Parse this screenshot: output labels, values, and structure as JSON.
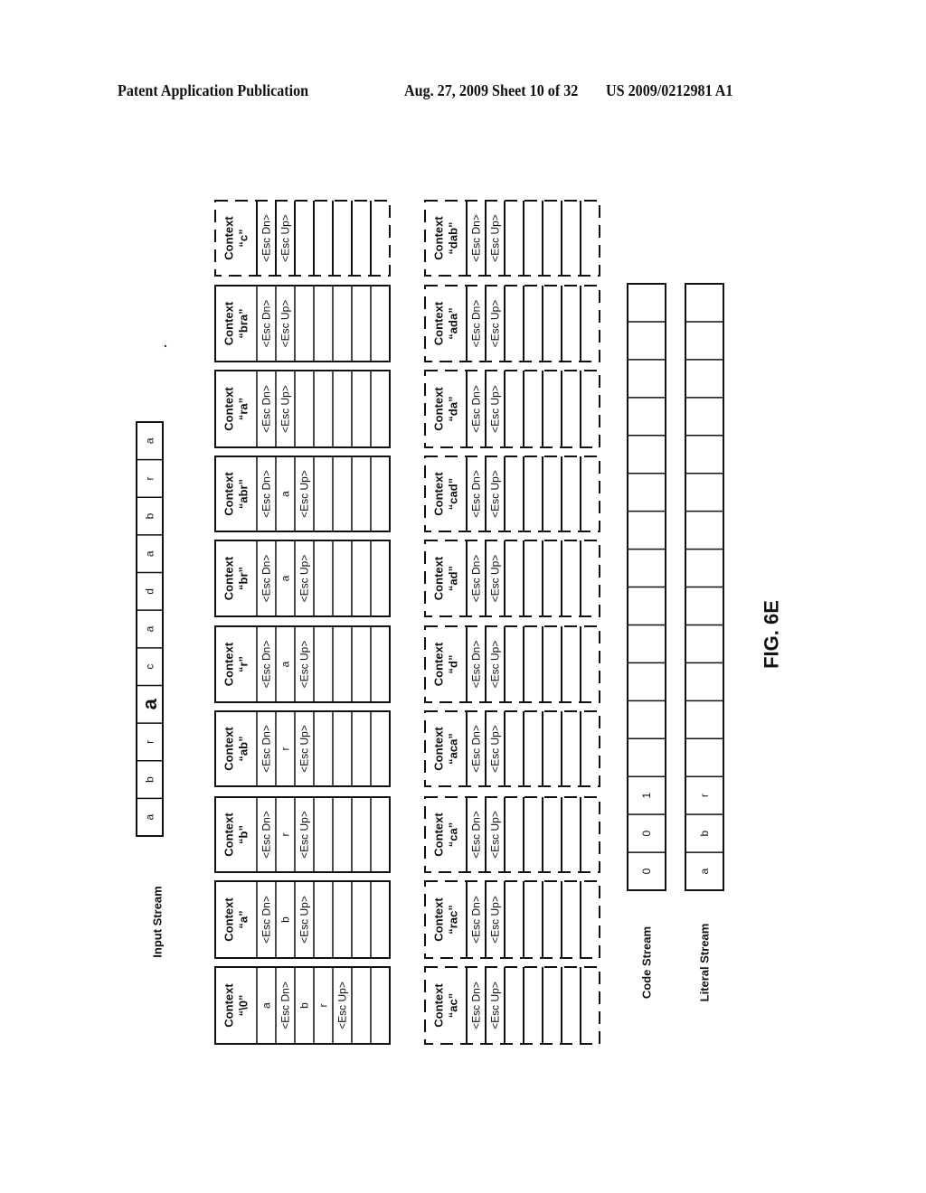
{
  "header": {
    "left": "Patent Application Publication",
    "middle": "Aug. 27, 2009  Sheet 10 of 32",
    "right": "US 2009/0212981 A1"
  },
  "figure": {
    "title": "FIG. 6E",
    "orientation": "rotated 90 degrees counter-clockwise",
    "input_stream": {
      "label": "Input Stream",
      "symbols": [
        "a",
        "b",
        "r",
        "a",
        "c",
        "a",
        "d",
        "a",
        "b",
        "r",
        "a"
      ],
      "highlighted_index": 3
    },
    "context_row_1": [
      {
        "name": "Context",
        "key": "“\\0”",
        "entries": [
          "a",
          "<Esc Dn>",
          "b",
          "r",
          "<Esc Up>",
          "",
          ""
        ],
        "style": "solid"
      },
      {
        "name": "Context",
        "key": "“a”",
        "entries": [
          "<Esc Dn>",
          "b",
          "<Esc Up>",
          "",
          "",
          "",
          ""
        ],
        "style": "solid"
      },
      {
        "name": "Context",
        "key": "“b”",
        "entries": [
          "<Esc Dn>",
          "r",
          "<Esc Up>",
          "",
          "",
          "",
          ""
        ],
        "style": "solid"
      },
      {
        "name": "Context",
        "key": "“ab”",
        "entries": [
          "<Esc Dn>",
          "r",
          "<Esc Up>",
          "",
          "",
          "",
          ""
        ],
        "style": "solid"
      },
      {
        "name": "Context",
        "key": "“r”",
        "entries": [
          "<Esc Dn>",
          "a",
          "<Esc Up>",
          "",
          "",
          "",
          ""
        ],
        "style": "solid"
      },
      {
        "name": "Context",
        "key": "“br”",
        "entries": [
          "<Esc Dn>",
          "a",
          "<Esc Up>",
          "",
          "",
          "",
          ""
        ],
        "style": "solid"
      },
      {
        "name": "Context",
        "key": "“abr”",
        "entries": [
          "<Esc Dn>",
          "a",
          "<Esc Up>",
          "",
          "",
          "",
          ""
        ],
        "style": "solid"
      },
      {
        "name": "Context",
        "key": "“ra”",
        "entries": [
          "<Esc Dn>",
          "<Esc Up>",
          "",
          "",
          "",
          "",
          ""
        ],
        "style": "solid"
      },
      {
        "name": "Context",
        "key": "“bra”",
        "entries": [
          "<Esc Dn>",
          "<Esc Up>",
          "",
          "",
          "",
          "",
          ""
        ],
        "style": "solid"
      },
      {
        "name": "Context",
        "key": "“c”",
        "entries": [
          "<Esc Dn>",
          "<Esc Up>",
          "",
          "",
          "",
          "",
          ""
        ],
        "style": "dashed"
      }
    ],
    "context_row_2": [
      {
        "name": "Context",
        "key": "“ac”",
        "entries": [
          "<Esc Dn>",
          "<Esc Up>",
          "",
          "",
          "",
          "",
          ""
        ],
        "style": "dashed"
      },
      {
        "name": "Context",
        "key": "“rac”",
        "entries": [
          "<Esc Dn>",
          "<Esc Up>",
          "",
          "",
          "",
          "",
          ""
        ],
        "style": "dashed"
      },
      {
        "name": "Context",
        "key": "“ca”",
        "entries": [
          "<Esc Dn>",
          "<Esc Up>",
          "",
          "",
          "",
          "",
          ""
        ],
        "style": "dashed"
      },
      {
        "name": "Context",
        "key": "“aca”",
        "entries": [
          "<Esc Dn>",
          "<Esc Up>",
          "",
          "",
          "",
          "",
          ""
        ],
        "style": "dashed"
      },
      {
        "name": "Context",
        "key": "“d”",
        "entries": [
          "<Esc Dn>",
          "<Esc Up>",
          "",
          "",
          "",
          "",
          ""
        ],
        "style": "dashed"
      },
      {
        "name": "Context",
        "key": "“ad”",
        "entries": [
          "<Esc Dn>",
          "<Esc Up>",
          "",
          "",
          "",
          "",
          ""
        ],
        "style": "dashed"
      },
      {
        "name": "Context",
        "key": "“cad”",
        "entries": [
          "<Esc Dn>",
          "<Esc Up>",
          "",
          "",
          "",
          "",
          ""
        ],
        "style": "dashed"
      },
      {
        "name": "Context",
        "key": "“da”",
        "entries": [
          "<Esc Dn>",
          "<Esc Up>",
          "",
          "",
          "",
          "",
          ""
        ],
        "style": "dashed"
      },
      {
        "name": "Context",
        "key": "“ada”",
        "entries": [
          "<Esc Dn>",
          "<Esc Up>",
          "",
          "",
          "",
          "",
          ""
        ],
        "style": "dashed"
      },
      {
        "name": "Context",
        "key": "“dab”",
        "entries": [
          "<Esc Dn>",
          "<Esc Up>",
          "",
          "",
          "",
          "",
          ""
        ],
        "style": "dashed"
      }
    ],
    "code_stream": {
      "label": "Code Stream",
      "cells": [
        "0",
        "0",
        "1",
        "",
        "",
        "",
        "",
        "",
        "",
        "",
        "",
        "",
        "",
        "",
        "",
        ""
      ]
    },
    "literal_stream": {
      "label": "Literal Stream",
      "cells": [
        "a",
        "b",
        "r",
        "",
        "",
        "",
        "",
        "",
        "",
        "",
        "",
        "",
        "",
        "",
        "",
        ""
      ]
    }
  }
}
